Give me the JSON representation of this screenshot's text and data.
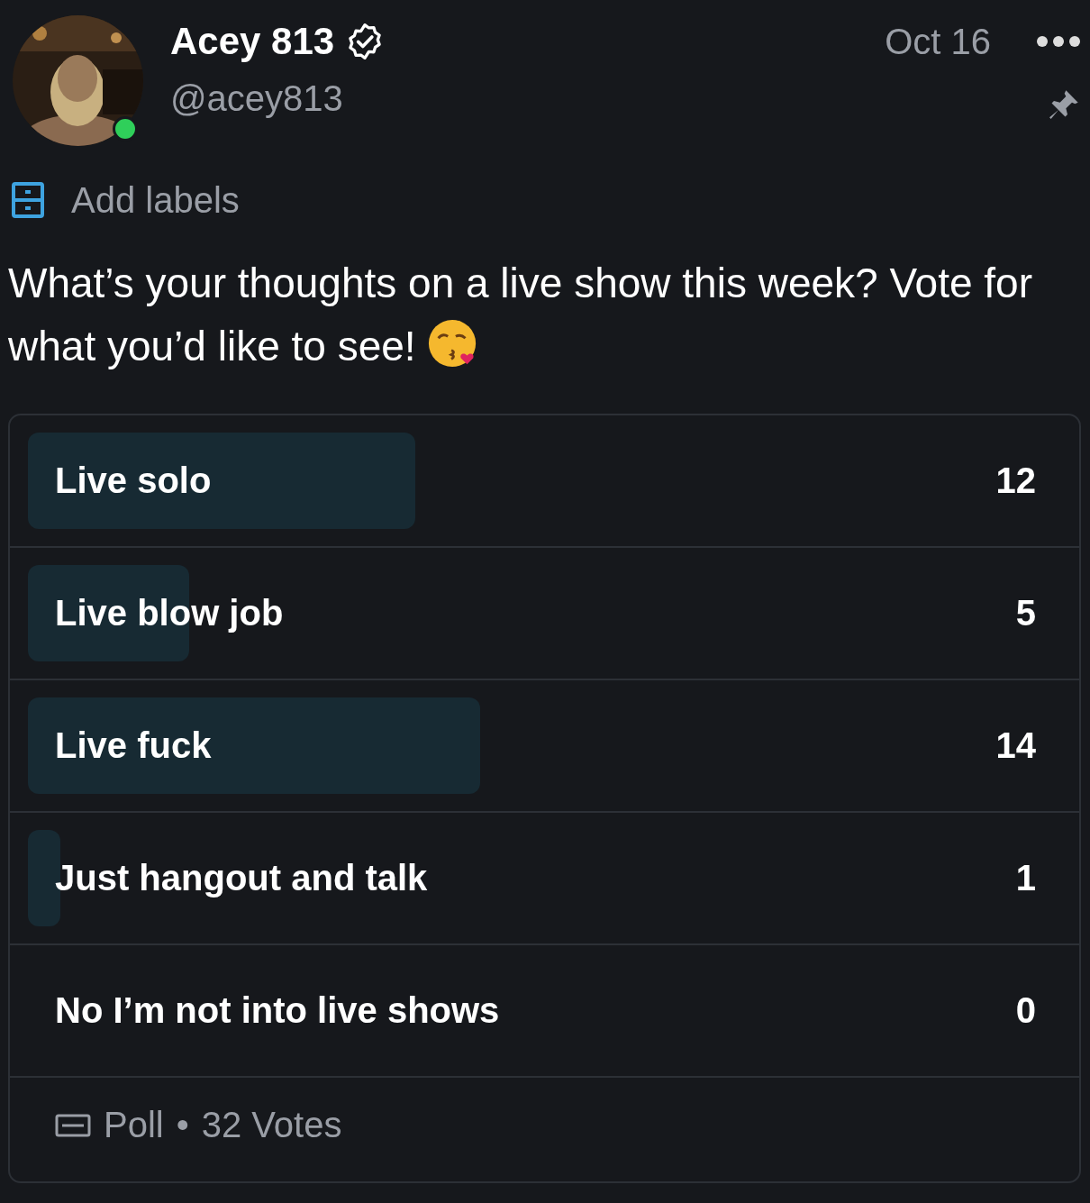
{
  "post": {
    "author": "Acey 813",
    "verified": true,
    "handle": "@acey813",
    "online": true,
    "date": "Oct 16",
    "pinned": true,
    "labels_action": "Add labels",
    "text": "What’s your thoughts on a live show this week? Vote for what you’d like to see!"
  },
  "poll": {
    "options": [
      {
        "label": "Live solo",
        "count": "12"
      },
      {
        "label": "Live blow job",
        "count": "5"
      },
      {
        "label": "Live fuck",
        "count": "14"
      },
      {
        "label": "Just hangout and talk",
        "count": "1"
      },
      {
        "label": "No I’m not into live shows",
        "count": "0"
      }
    ],
    "type_label": "Poll",
    "separator": "•",
    "votes": "32 Votes"
  }
}
